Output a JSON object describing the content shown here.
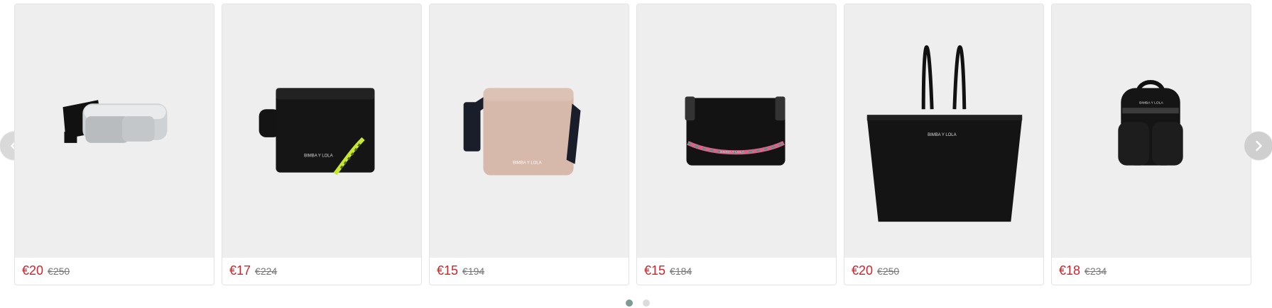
{
  "carousel": {
    "prev_icon": "chevron-left-icon",
    "next_icon": "chevron-right-icon",
    "products": [
      {
        "image": "silver-belt-bag",
        "price": "€20",
        "old_price": "€250"
      },
      {
        "image": "black-crossbody-bag-neon-chain",
        "price": "€17",
        "old_price": "€224"
      },
      {
        "image": "beige-crossbody-bag-logo-strap",
        "price": "€15",
        "old_price": "€194"
      },
      {
        "image": "black-shoulder-bag-pink-chain",
        "price": "€15",
        "old_price": "€184"
      },
      {
        "image": "black-tote-bag",
        "price": "€20",
        "old_price": "€250"
      },
      {
        "image": "black-mini-backpack",
        "price": "€18",
        "old_price": "€234"
      }
    ],
    "pagination": {
      "count": 2,
      "active": 1
    },
    "colors": {
      "sale_price": "#d2232a",
      "old_price": "#777777",
      "active_dot": "#7f9a93",
      "card_bg": "#efeeee"
    }
  }
}
